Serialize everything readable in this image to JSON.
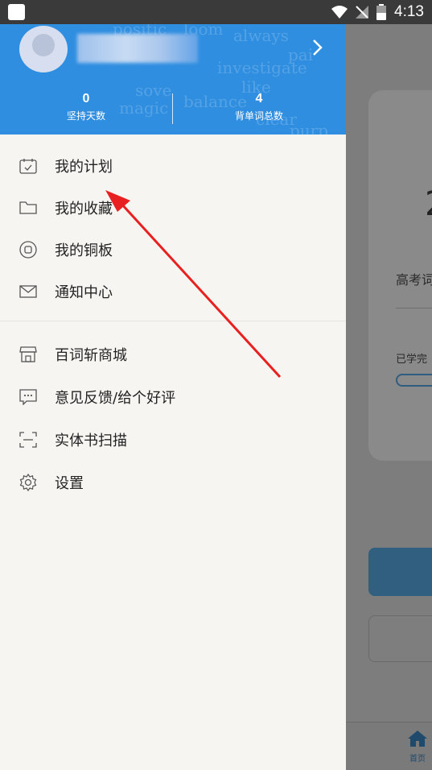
{
  "status_bar": {
    "time": "4:13"
  },
  "drawer": {
    "stats": [
      {
        "value": "0",
        "label": "坚持天数"
      },
      {
        "value": "4",
        "label": "背单词总数"
      }
    ],
    "menu_primary": [
      {
        "label": "我的计划",
        "icon": "calendar-icon"
      },
      {
        "label": "我的收藏",
        "icon": "folder-icon"
      },
      {
        "label": "我的铜板",
        "icon": "coin-icon"
      },
      {
        "label": "通知中心",
        "icon": "mail-icon"
      }
    ],
    "menu_secondary": [
      {
        "label": "百词斩商城",
        "icon": "store-icon"
      },
      {
        "label": "意见反馈/给个好评",
        "icon": "feedback-icon"
      },
      {
        "label": "实体书扫描",
        "icon": "scan-icon"
      },
      {
        "label": "设置",
        "icon": "gear-icon"
      }
    ]
  },
  "background_app": {
    "big_number": "2",
    "subtitle": "高考词",
    "progress_label": "已学完",
    "tab_home": "首页"
  },
  "colors": {
    "header_blue": "#2f8ee0",
    "drawer_bg": "#f6f5f1",
    "annotation_red": "#e8201f"
  }
}
